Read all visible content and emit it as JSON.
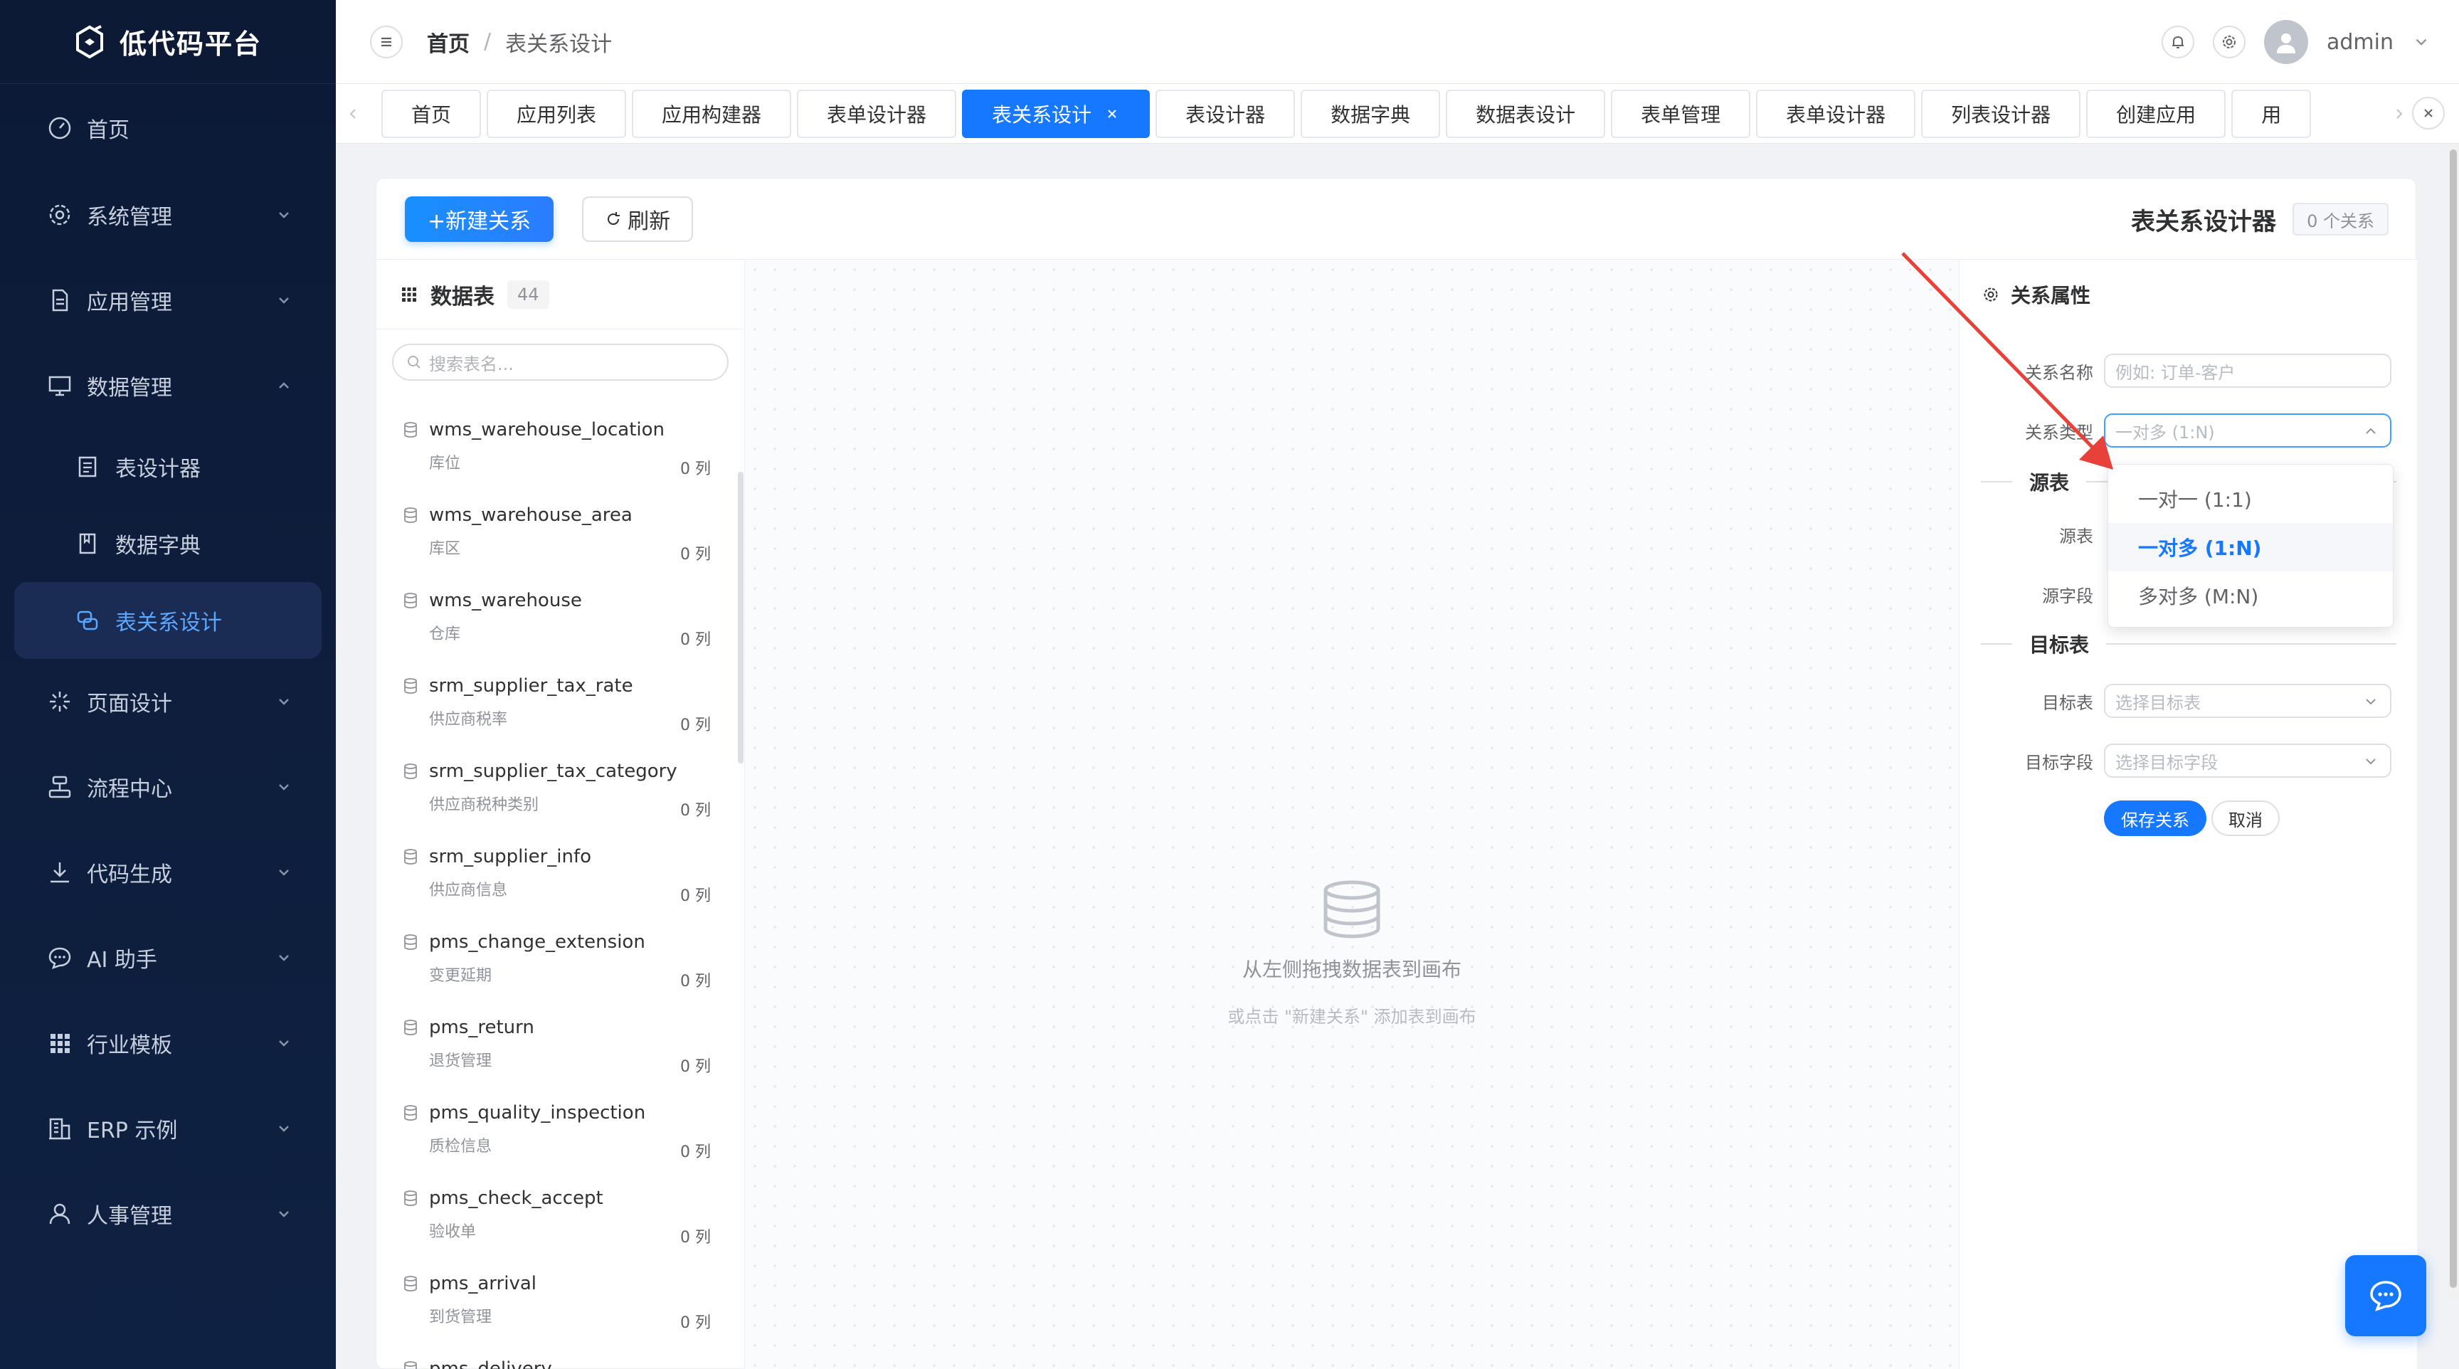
{
  "app": {
    "title": "低代码平台"
  },
  "sidebar": {
    "items": [
      {
        "label": "首页",
        "icon": "dashboard-icon"
      },
      {
        "label": "系统管理",
        "icon": "gear-icon"
      },
      {
        "label": "应用管理",
        "icon": "document-icon"
      },
      {
        "label": "数据管理",
        "icon": "monitor-icon",
        "expanded": true
      },
      {
        "label": "页面设计",
        "icon": "sparkle-icon"
      },
      {
        "label": "流程中心",
        "icon": "flow-icon"
      },
      {
        "label": "代码生成",
        "icon": "download-icon"
      },
      {
        "label": "AI 助手",
        "icon": "chat-icon"
      },
      {
        "label": "行业模板",
        "icon": "grid-icon"
      },
      {
        "label": "ERP 示例",
        "icon": "building-icon"
      },
      {
        "label": "人事管理",
        "icon": "user-icon"
      }
    ],
    "sub_items": [
      {
        "label": "表设计器",
        "icon": "form-icon"
      },
      {
        "label": "数据字典",
        "icon": "book-icon"
      },
      {
        "label": "表关系设计",
        "icon": "link-icon",
        "active": true
      }
    ]
  },
  "header": {
    "breadcrumb": {
      "home": "首页",
      "separator": "/",
      "current": "表关系设计"
    },
    "user": "admin"
  },
  "tabs": [
    {
      "label": "首页"
    },
    {
      "label": "应用列表"
    },
    {
      "label": "应用构建器"
    },
    {
      "label": "表单设计器"
    },
    {
      "label": "表关系设计",
      "active": true
    },
    {
      "label": "表设计器"
    },
    {
      "label": "数据字典"
    },
    {
      "label": "数据表设计"
    },
    {
      "label": "表单管理"
    },
    {
      "label": "表单设计器"
    },
    {
      "label": "列表设计器"
    },
    {
      "label": "创建应用"
    },
    {
      "label": "用"
    }
  ],
  "toolbar": {
    "new_label": "+新建关系",
    "refresh_label": "刷新",
    "designer_title": "表关系设计器",
    "relation_count": "0 个关系"
  },
  "table_panel": {
    "title": "数据表",
    "count": "44",
    "search_placeholder": "搜索表名...",
    "tables": [
      {
        "name": "wms_warehouse_location",
        "desc": "库位",
        "cols": "0 列"
      },
      {
        "name": "wms_warehouse_area",
        "desc": "库区",
        "cols": "0 列"
      },
      {
        "name": "wms_warehouse",
        "desc": "仓库",
        "cols": "0 列"
      },
      {
        "name": "srm_supplier_tax_rate",
        "desc": "供应商税率",
        "cols": "0 列"
      },
      {
        "name": "srm_supplier_tax_category",
        "desc": "供应商税种类别",
        "cols": "0 列"
      },
      {
        "name": "srm_supplier_info",
        "desc": "供应商信息",
        "cols": "0 列"
      },
      {
        "name": "pms_change_extension",
        "desc": "变更延期",
        "cols": "0 列"
      },
      {
        "name": "pms_return",
        "desc": "退货管理",
        "cols": "0 列"
      },
      {
        "name": "pms_quality_inspection",
        "desc": "质检信息",
        "cols": "0 列"
      },
      {
        "name": "pms_check_accept",
        "desc": "验收单",
        "cols": "0 列"
      },
      {
        "name": "pms_arrival",
        "desc": "到货管理",
        "cols": "0 列"
      },
      {
        "name": "pms_delivery",
        "desc": "",
        "cols": ""
      }
    ]
  },
  "canvas": {
    "empty_main": "从左侧拖拽数据表到画布",
    "empty_sub": "或点击 \"新建关系\" 添加表到画布"
  },
  "props": {
    "title": "关系属性",
    "name_label": "关系名称",
    "name_placeholder": "例如: 订单-客户",
    "type_label": "关系类型",
    "type_value": "一对多 (1:N)",
    "source_section": "源表",
    "source_table_label": "源表",
    "source_field_label": "源字段",
    "target_section": "目标表",
    "target_table_label": "目标表",
    "target_table_placeholder": "选择目标表",
    "target_field_label": "目标字段",
    "target_field_placeholder": "选择目标字段",
    "save_label": "保存关系",
    "cancel_label": "取消"
  },
  "dropdown": {
    "options": [
      {
        "label": "一对一 (1:1)"
      },
      {
        "label": "一对多 (1:N)",
        "selected": true
      },
      {
        "label": "多对多 (M:N)"
      }
    ]
  },
  "colors": {
    "sidebar_bg": "#0c1a36",
    "primary": "#1677ff",
    "active_menu_text": "#5aa8ff",
    "annotation": "#e8413a"
  }
}
